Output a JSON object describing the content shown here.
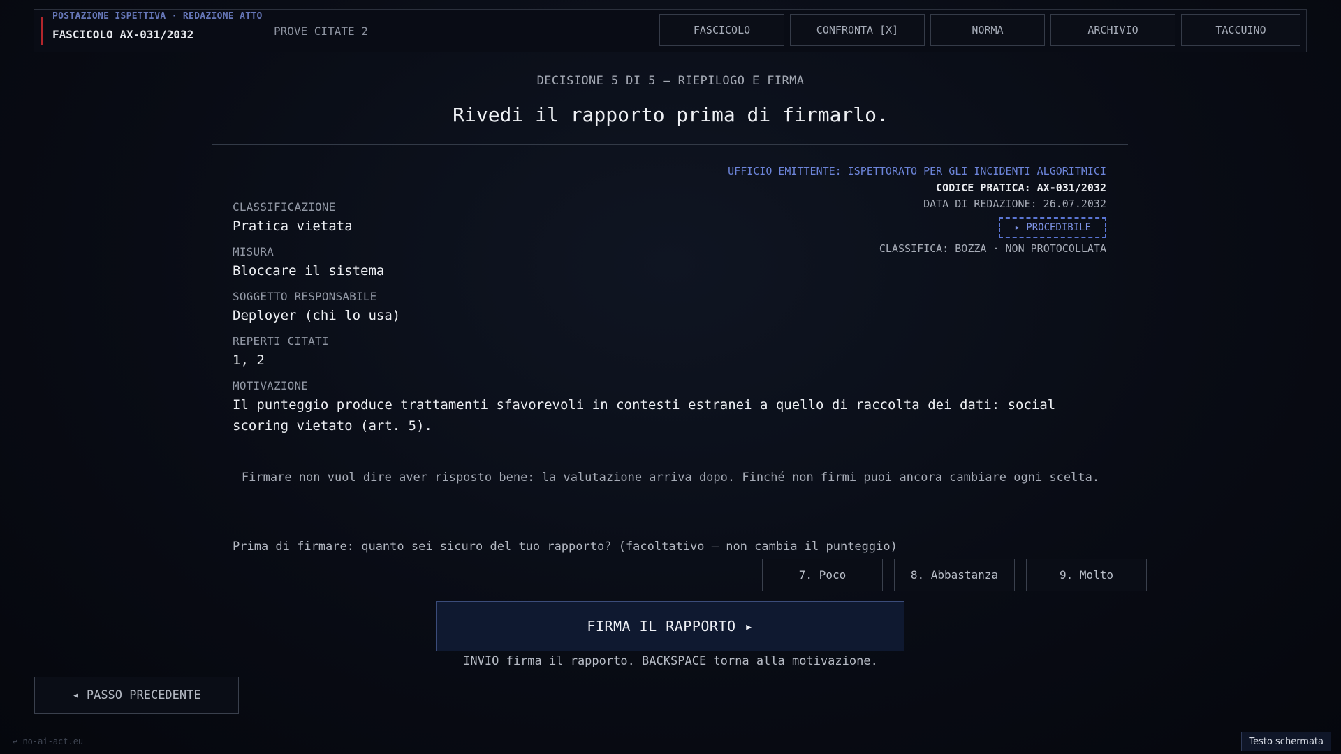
{
  "header": {
    "breadcrumb": "POSTAZIONE ISPETTIVA · REDAZIONE ATTO",
    "case_id": "FASCICOLO AX-031/2032",
    "evidence_cited": "PROVE CITATE 2",
    "accent_color": "#b3262c",
    "nav": [
      {
        "label": "FASCICOLO"
      },
      {
        "label": "CONFRONTA [X]"
      },
      {
        "label": "NORMA"
      },
      {
        "label": "ARCHIVIO"
      },
      {
        "label": "TACCUINO"
      }
    ]
  },
  "step": "DECISIONE 5 DI 5 — RIEPILOGO E FIRMA",
  "title": "Rivedi il rapporto prima di firmarlo.",
  "issuer": {
    "office": "UFFICIO EMITTENTE: ISPETTORATO PER GLI INCIDENTI ALGORITMICI",
    "code": "CODICE PRATICA: AX-031/2032",
    "date": "DATA DI REDAZIONE: 26.07.2032",
    "stamp": "▸ PROCEDIBILE",
    "classification": "CLASSIFICA: BOZZA · NON PROTOCOLLATA",
    "office_color": "#6c84d9"
  },
  "fields": [
    {
      "label": "CLASSIFICAZIONE",
      "value": "Pratica vietata"
    },
    {
      "label": "MISURA",
      "value": "Bloccare il sistema"
    },
    {
      "label": "SOGGETTO RESPONSABILE",
      "value": "Deployer (chi lo usa)"
    },
    {
      "label": "REPERTI CITATI",
      "value": "1, 2"
    },
    {
      "label": "MOTIVAZIONE",
      "value": "Il punteggio produce trattamenti sfavorevoli in contesti estranei a quello di raccolta dei dati: social scoring vietato (art. 5)."
    }
  ],
  "notice": "Firmare non vuol dire aver risposto bene: la valutazione arriva dopo. Finché non firmi puoi ancora cambiare ogni scelta.",
  "confidence": {
    "question": "Prima di firmare: quanto sei sicuro del tuo rapporto? (facoltativo — non cambia il punteggio)",
    "options": [
      {
        "label": "7. Poco"
      },
      {
        "label": "8. Abbastanza"
      },
      {
        "label": "9. Molto"
      }
    ]
  },
  "sign_button": "FIRMA IL RAPPORTO ▸",
  "hint": "INVIO firma il rapporto. BACKSPACE torna alla motivazione.",
  "back_button": "◂ PASSO PRECEDENTE",
  "footer_link": "↩ no-ai-act.eu",
  "screen_text_button": "Testo schermata"
}
